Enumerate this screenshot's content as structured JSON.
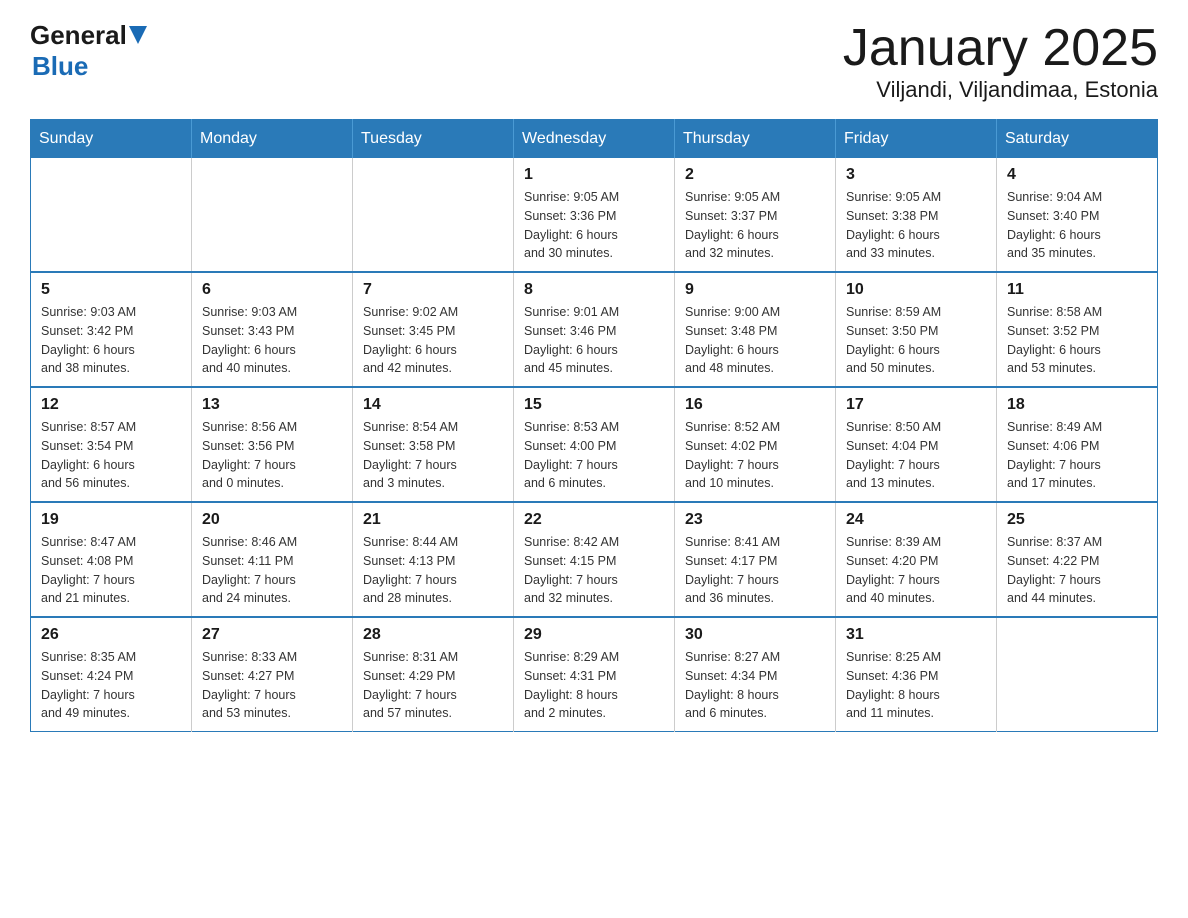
{
  "logo": {
    "general": "General",
    "blue": "Blue"
  },
  "header": {
    "title": "January 2025",
    "subtitle": "Viljandi, Viljandimaa, Estonia"
  },
  "days_of_week": [
    "Sunday",
    "Monday",
    "Tuesday",
    "Wednesday",
    "Thursday",
    "Friday",
    "Saturday"
  ],
  "weeks": [
    [
      {
        "day": "",
        "info": ""
      },
      {
        "day": "",
        "info": ""
      },
      {
        "day": "",
        "info": ""
      },
      {
        "day": "1",
        "info": "Sunrise: 9:05 AM\nSunset: 3:36 PM\nDaylight: 6 hours\nand 30 minutes."
      },
      {
        "day": "2",
        "info": "Sunrise: 9:05 AM\nSunset: 3:37 PM\nDaylight: 6 hours\nand 32 minutes."
      },
      {
        "day": "3",
        "info": "Sunrise: 9:05 AM\nSunset: 3:38 PM\nDaylight: 6 hours\nand 33 minutes."
      },
      {
        "day": "4",
        "info": "Sunrise: 9:04 AM\nSunset: 3:40 PM\nDaylight: 6 hours\nand 35 minutes."
      }
    ],
    [
      {
        "day": "5",
        "info": "Sunrise: 9:03 AM\nSunset: 3:42 PM\nDaylight: 6 hours\nand 38 minutes."
      },
      {
        "day": "6",
        "info": "Sunrise: 9:03 AM\nSunset: 3:43 PM\nDaylight: 6 hours\nand 40 minutes."
      },
      {
        "day": "7",
        "info": "Sunrise: 9:02 AM\nSunset: 3:45 PM\nDaylight: 6 hours\nand 42 minutes."
      },
      {
        "day": "8",
        "info": "Sunrise: 9:01 AM\nSunset: 3:46 PM\nDaylight: 6 hours\nand 45 minutes."
      },
      {
        "day": "9",
        "info": "Sunrise: 9:00 AM\nSunset: 3:48 PM\nDaylight: 6 hours\nand 48 minutes."
      },
      {
        "day": "10",
        "info": "Sunrise: 8:59 AM\nSunset: 3:50 PM\nDaylight: 6 hours\nand 50 minutes."
      },
      {
        "day": "11",
        "info": "Sunrise: 8:58 AM\nSunset: 3:52 PM\nDaylight: 6 hours\nand 53 minutes."
      }
    ],
    [
      {
        "day": "12",
        "info": "Sunrise: 8:57 AM\nSunset: 3:54 PM\nDaylight: 6 hours\nand 56 minutes."
      },
      {
        "day": "13",
        "info": "Sunrise: 8:56 AM\nSunset: 3:56 PM\nDaylight: 7 hours\nand 0 minutes."
      },
      {
        "day": "14",
        "info": "Sunrise: 8:54 AM\nSunset: 3:58 PM\nDaylight: 7 hours\nand 3 minutes."
      },
      {
        "day": "15",
        "info": "Sunrise: 8:53 AM\nSunset: 4:00 PM\nDaylight: 7 hours\nand 6 minutes."
      },
      {
        "day": "16",
        "info": "Sunrise: 8:52 AM\nSunset: 4:02 PM\nDaylight: 7 hours\nand 10 minutes."
      },
      {
        "day": "17",
        "info": "Sunrise: 8:50 AM\nSunset: 4:04 PM\nDaylight: 7 hours\nand 13 minutes."
      },
      {
        "day": "18",
        "info": "Sunrise: 8:49 AM\nSunset: 4:06 PM\nDaylight: 7 hours\nand 17 minutes."
      }
    ],
    [
      {
        "day": "19",
        "info": "Sunrise: 8:47 AM\nSunset: 4:08 PM\nDaylight: 7 hours\nand 21 minutes."
      },
      {
        "day": "20",
        "info": "Sunrise: 8:46 AM\nSunset: 4:11 PM\nDaylight: 7 hours\nand 24 minutes."
      },
      {
        "day": "21",
        "info": "Sunrise: 8:44 AM\nSunset: 4:13 PM\nDaylight: 7 hours\nand 28 minutes."
      },
      {
        "day": "22",
        "info": "Sunrise: 8:42 AM\nSunset: 4:15 PM\nDaylight: 7 hours\nand 32 minutes."
      },
      {
        "day": "23",
        "info": "Sunrise: 8:41 AM\nSunset: 4:17 PM\nDaylight: 7 hours\nand 36 minutes."
      },
      {
        "day": "24",
        "info": "Sunrise: 8:39 AM\nSunset: 4:20 PM\nDaylight: 7 hours\nand 40 minutes."
      },
      {
        "day": "25",
        "info": "Sunrise: 8:37 AM\nSunset: 4:22 PM\nDaylight: 7 hours\nand 44 minutes."
      }
    ],
    [
      {
        "day": "26",
        "info": "Sunrise: 8:35 AM\nSunset: 4:24 PM\nDaylight: 7 hours\nand 49 minutes."
      },
      {
        "day": "27",
        "info": "Sunrise: 8:33 AM\nSunset: 4:27 PM\nDaylight: 7 hours\nand 53 minutes."
      },
      {
        "day": "28",
        "info": "Sunrise: 8:31 AM\nSunset: 4:29 PM\nDaylight: 7 hours\nand 57 minutes."
      },
      {
        "day": "29",
        "info": "Sunrise: 8:29 AM\nSunset: 4:31 PM\nDaylight: 8 hours\nand 2 minutes."
      },
      {
        "day": "30",
        "info": "Sunrise: 8:27 AM\nSunset: 4:34 PM\nDaylight: 8 hours\nand 6 minutes."
      },
      {
        "day": "31",
        "info": "Sunrise: 8:25 AM\nSunset: 4:36 PM\nDaylight: 8 hours\nand 11 minutes."
      },
      {
        "day": "",
        "info": ""
      }
    ]
  ]
}
